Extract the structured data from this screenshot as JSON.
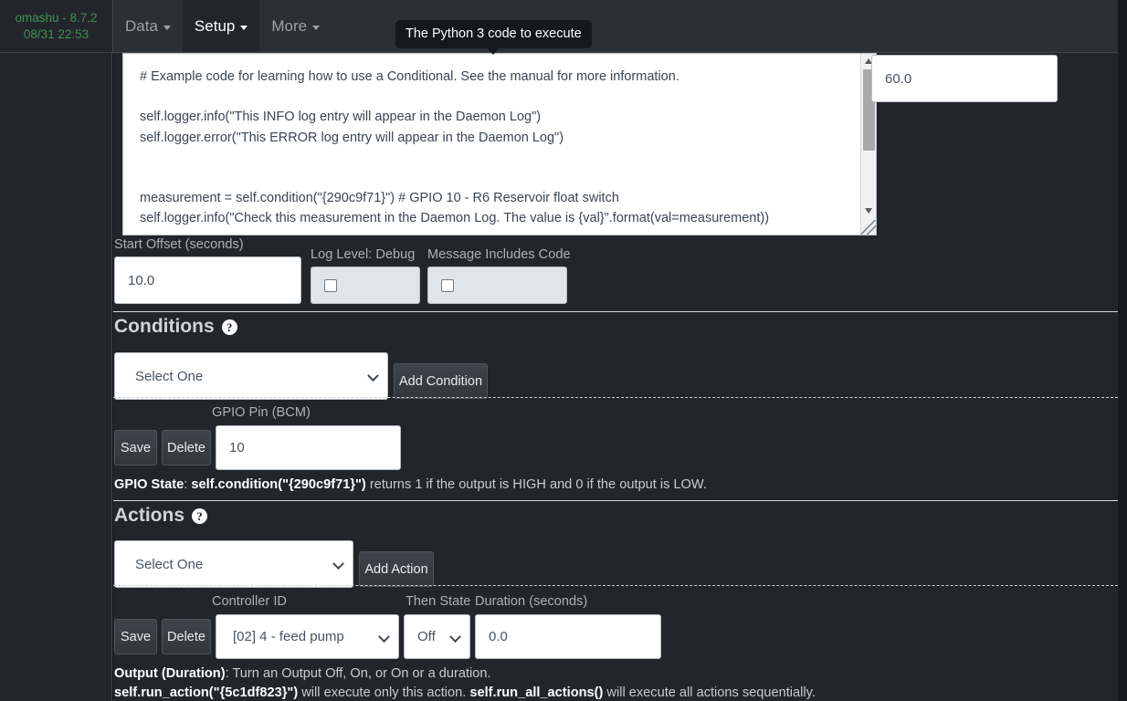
{
  "navbar": {
    "brand_name": "omashu - 8.7.2",
    "brand_time": "08/31 22:53",
    "items": [
      {
        "label": "Data",
        "active": false
      },
      {
        "label": "Setup",
        "active": true
      },
      {
        "label": "More",
        "active": false
      }
    ]
  },
  "tooltip": {
    "text": "The Python 3 code to execute"
  },
  "editor": {
    "code": "# Example code for learning how to use a Conditional. See the manual for more information.\n\nself.logger.info(\"This INFO log entry will appear in the Daemon Log\")\nself.logger.error(\"This ERROR log entry will appear in the Daemon Log\")\n\n\nmeasurement = self.condition(\"{290c9f71}\") # GPIO 10 - R6 Reservoir float switch\nself.logger.info(\"Check this measurement in the Daemon Log. The value is {val}\".format(val=measurement))\n\nif measurement is not None:  # If a measurement exists"
  },
  "period": {
    "value": "60.0"
  },
  "options_row": {
    "start_offset_label": "Start Offset (seconds)",
    "start_offset_value": "10.0",
    "log_level_debug_label": "Log Level: Debug",
    "log_level_debug_checked": false,
    "message_includes_code_label": "Message Includes Code",
    "message_includes_code_checked": false
  },
  "conditions": {
    "title": "Conditions",
    "help_icon": "question-mark-icon",
    "select_value": "Select One",
    "add_button": "Add Condition",
    "row": {
      "save_label": "Save",
      "delete_label": "Delete",
      "gpio_pin_label": "GPIO Pin (BCM)",
      "gpio_pin_value": "10"
    },
    "description_bold": "GPIO State",
    "description_code": "self.condition(\"{290c9f71}\")",
    "description_rest": " returns 1 if the output is HIGH and 0 if the output is LOW.",
    "description_sep": ": "
  },
  "actions": {
    "title": "Actions",
    "help_icon": "question-mark-icon",
    "select_value": "Select One",
    "add_button": "Add Action",
    "row": {
      "save_label": "Save",
      "delete_label": "Delete",
      "controller_id_label": "Controller ID",
      "controller_id_value": "[02] 4 - feed pump",
      "then_state_label": "Then State",
      "then_state_value": "Off",
      "duration_label": "Duration (seconds)",
      "duration_value": "0.0"
    },
    "desc_line1_bold": "Output (Duration)",
    "desc_line1_rest": ": Turn an Output Off, On, or On or a duration.",
    "desc_line2_code1": "self.run_action(\"{5c1df823}\")",
    "desc_line2_mid": " will execute only this action. ",
    "desc_line2_code2": "self.run_all_actions()",
    "desc_line2_end": " will execute all actions sequentially."
  },
  "colors": {
    "background": "#22262b",
    "navbar": "#2b3035",
    "brand_green": "#3f8f52",
    "text": "#c5ccd3",
    "divider": "#d6dade"
  }
}
